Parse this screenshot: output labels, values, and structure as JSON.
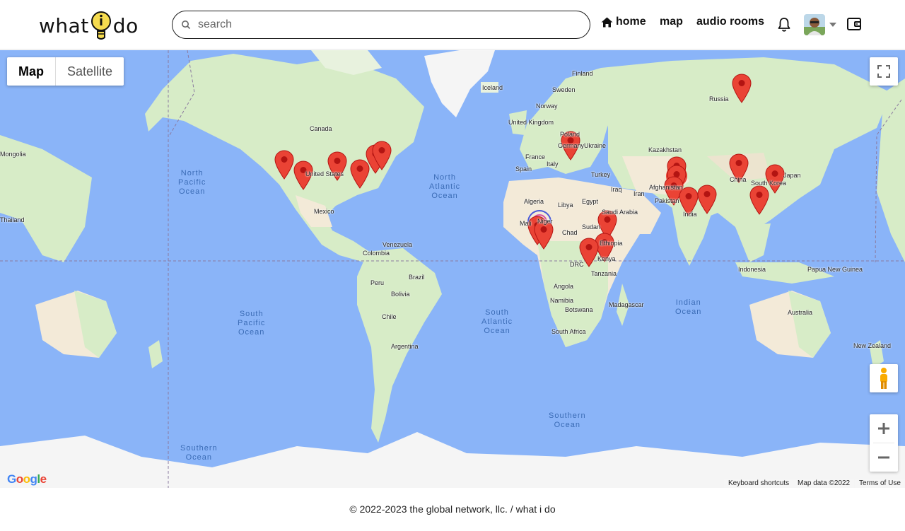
{
  "header": {
    "logo_left": "what",
    "logo_right": "do",
    "search_placeholder": "search",
    "nav": {
      "home": "home",
      "map": "map",
      "audio_rooms": "audio rooms"
    }
  },
  "map": {
    "type_control": {
      "map": "Map",
      "satellite": "Satellite"
    },
    "google": "Google",
    "attribution": {
      "shortcuts": "Keyboard shortcuts",
      "data": "Map data ©2022",
      "terms": "Terms of Use"
    },
    "country_labels": [
      "Canada",
      "United States",
      "Mexico",
      "Colombia",
      "Venezuela",
      "Peru",
      "Brazil",
      "Bolivia",
      "Chile",
      "Argentina",
      "Iceland",
      "Finland",
      "Sweden",
      "Norway",
      "United Kingdom",
      "Germany",
      "France",
      "Spain",
      "Italy",
      "Ukraine",
      "Poland",
      "Turkey",
      "Iraq",
      "Iran",
      "Afghanistan",
      "Pakistan",
      "India",
      "China",
      "Kazakhstan",
      "Russia",
      "Mongolia",
      "Japan",
      "South Korea",
      "Thailand",
      "Indonesia",
      "Papua New Guinea",
      "Australia",
      "New Zealand",
      "Algeria",
      "Libya",
      "Egypt",
      "Mali",
      "Niger",
      "Chad",
      "Sudan",
      "Saudi Arabia",
      "Ethiopia",
      "Kenya",
      "DRC",
      "Tanzania",
      "Angola",
      "Namibia",
      "Botswana",
      "Madagascar",
      "South Africa"
    ],
    "oceans": {
      "north_pacific": [
        "North",
        "Pacific",
        "Ocean"
      ],
      "south_pacific": [
        "South",
        "Pacific",
        "Ocean"
      ],
      "north_atlantic": [
        "North",
        "Atlantic",
        "Ocean"
      ],
      "south_atlantic": [
        "South",
        "Atlantic",
        "Ocean"
      ],
      "indian": [
        "Indian",
        "Ocean"
      ],
      "southern_1": [
        "Southern",
        "Ocean"
      ],
      "southern_2": [
        "Southern",
        "Ocean"
      ]
    }
  },
  "footer": {
    "copyright": "© 2022-2023 the global network, llc. / what i do"
  },
  "colors": {
    "water": "#8ab4f8",
    "land": "#d7ecc7",
    "desert": "#f3ead8",
    "ice": "#f5f5f5",
    "marker": "#ea4335"
  }
}
